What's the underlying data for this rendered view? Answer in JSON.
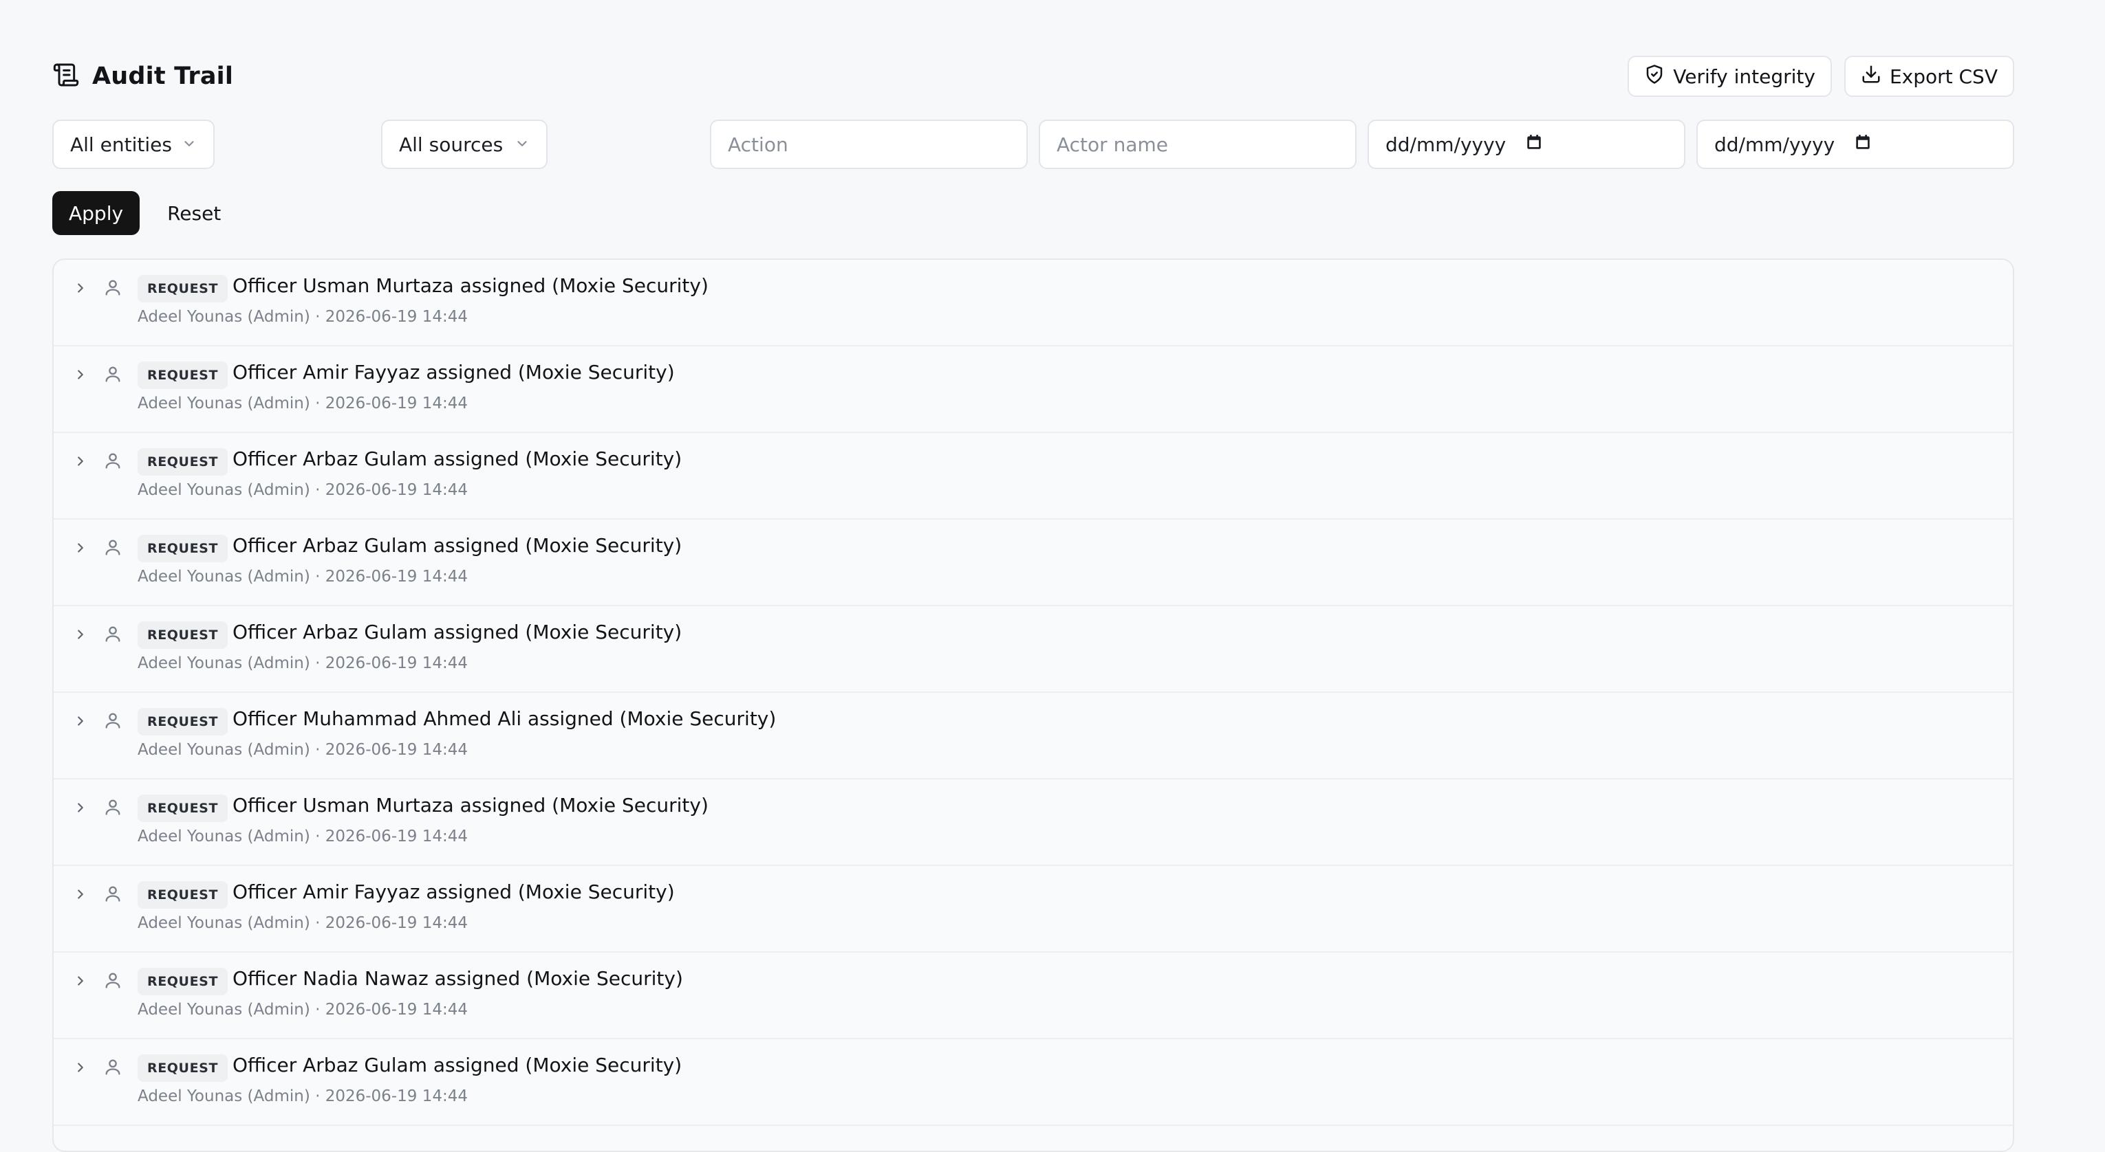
{
  "header": {
    "title": "Audit Trail",
    "verify_label": "Verify integrity",
    "export_label": "Export CSV"
  },
  "filters": {
    "entities": "All entities",
    "sources": "All sources",
    "action_placeholder": "Action",
    "actor_placeholder": "Actor name",
    "date_from": "dd/mm/yyyy",
    "date_to": "dd/mm/yyyy",
    "apply_label": "Apply",
    "reset_label": "Reset"
  },
  "rows": [
    {
      "badge": "REQUEST",
      "title": "Officer Usman Murtaza assigned (Moxie Security)",
      "meta": "Adeel Younas (Admin) · 2026-06-19 14:44"
    },
    {
      "badge": "REQUEST",
      "title": "Officer Amir Fayyaz assigned (Moxie Security)",
      "meta": "Adeel Younas (Admin) · 2026-06-19 14:44"
    },
    {
      "badge": "REQUEST",
      "title": "Officer Arbaz Gulam assigned (Moxie Security)",
      "meta": "Adeel Younas (Admin) · 2026-06-19 14:44"
    },
    {
      "badge": "REQUEST",
      "title": "Officer Arbaz Gulam assigned (Moxie Security)",
      "meta": "Adeel Younas (Admin) · 2026-06-19 14:44"
    },
    {
      "badge": "REQUEST",
      "title": "Officer Arbaz Gulam assigned (Moxie Security)",
      "meta": "Adeel Younas (Admin) · 2026-06-19 14:44"
    },
    {
      "badge": "REQUEST",
      "title": "Officer Muhammad Ahmed Ali assigned (Moxie Security)",
      "meta": "Adeel Younas (Admin) · 2026-06-19 14:44"
    },
    {
      "badge": "REQUEST",
      "title": "Officer Usman Murtaza assigned (Moxie Security)",
      "meta": "Adeel Younas (Admin) · 2026-06-19 14:44"
    },
    {
      "badge": "REQUEST",
      "title": "Officer Amir Fayyaz assigned (Moxie Security)",
      "meta": "Adeel Younas (Admin) · 2026-06-19 14:44"
    },
    {
      "badge": "REQUEST",
      "title": "Officer Nadia Nawaz assigned (Moxie Security)",
      "meta": "Adeel Younas (Admin) · 2026-06-19 14:44"
    },
    {
      "badge": "REQUEST",
      "title": "Officer Arbaz Gulam assigned (Moxie Security)",
      "meta": "Adeel Younas (Admin) · 2026-06-19 14:44"
    }
  ]
}
